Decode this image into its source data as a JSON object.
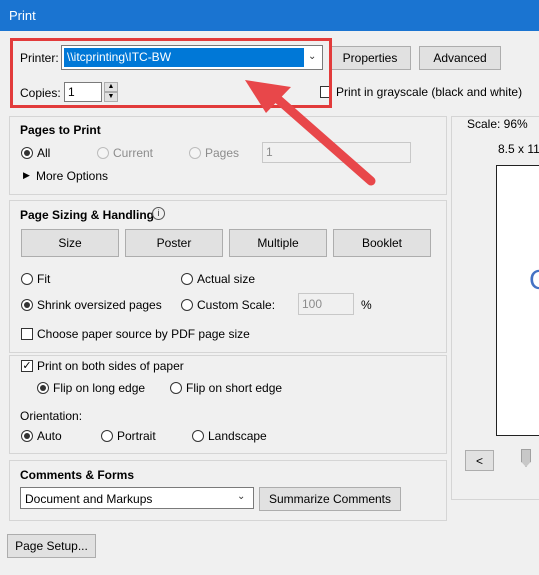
{
  "window": {
    "title": "Print"
  },
  "printer": {
    "label": "Printer:",
    "selected": "\\\\itcprinting\\ITC-BW",
    "properties_label": "Properties",
    "advanced_label": "Advanced"
  },
  "copies": {
    "label": "Copies:",
    "value": "1"
  },
  "grayscale": {
    "label": "Print in grayscale (black and white)",
    "checked": false
  },
  "pages_to_print": {
    "title": "Pages to Print",
    "all_label": "All",
    "current_label": "Current",
    "pages_label": "Pages",
    "pages_value": "1",
    "more_options_label": "More Options"
  },
  "sizing": {
    "title": "Page Sizing & Handling",
    "tabs": [
      "Size",
      "Poster",
      "Multiple",
      "Booklet"
    ],
    "fit_label": "Fit",
    "actual_size_label": "Actual size",
    "shrink_label": "Shrink oversized pages",
    "custom_scale_label": "Custom Scale:",
    "custom_scale_value": "100",
    "percent": "%",
    "paper_source_label": "Choose paper source by PDF page size"
  },
  "duplex": {
    "label": "Print on both sides of paper",
    "long_edge_label": "Flip on long edge",
    "short_edge_label": "Flip on short edge"
  },
  "orientation": {
    "label": "Orientation:",
    "auto_label": "Auto",
    "portrait_label": "Portrait",
    "landscape_label": "Landscape"
  },
  "comments": {
    "title": "Comments & Forms",
    "selected": "Document and Markups",
    "summarize_label": "Summarize Comments"
  },
  "page_setup_label": "Page Setup...",
  "preview": {
    "scale_text": "Scale:  96%",
    "page_size_text": "8.5 x 11",
    "preview_glyph": "C",
    "prev_label": "<"
  },
  "colors": {
    "highlight_border": "#e23b3b",
    "arrow": "#e8474a",
    "title_bar": "#1a74d1"
  }
}
